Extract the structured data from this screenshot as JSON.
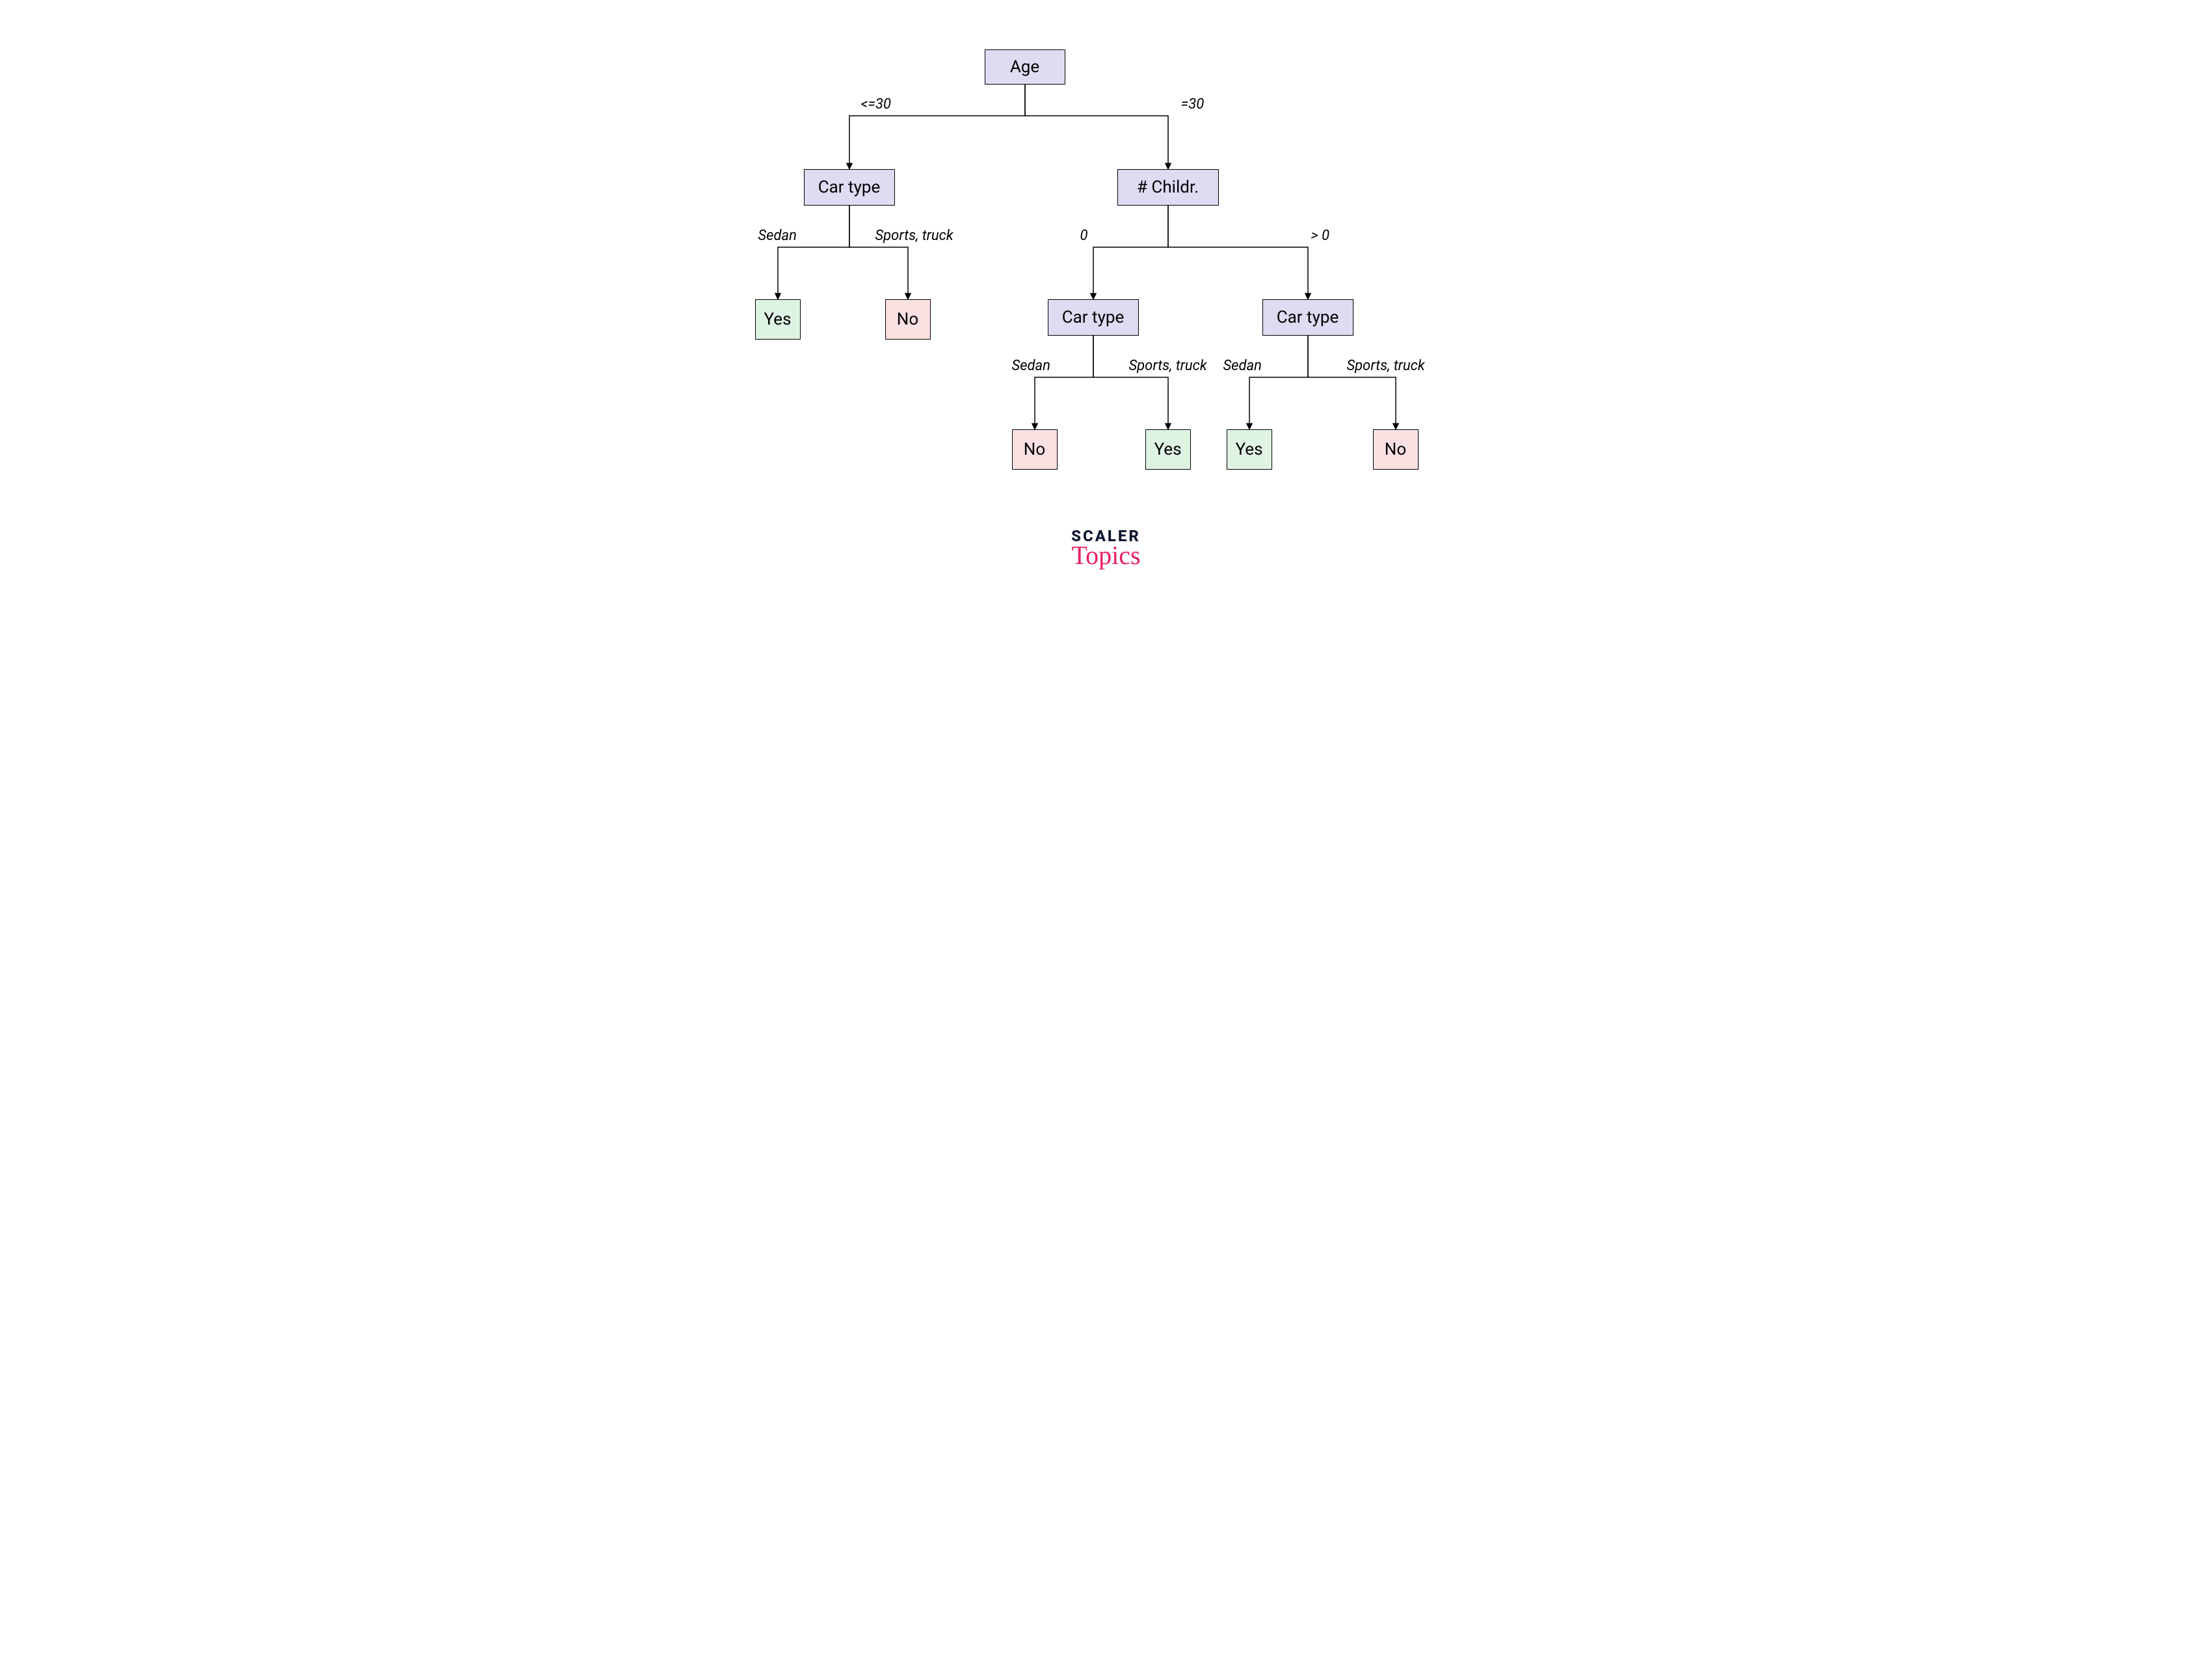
{
  "nodes": {
    "root": {
      "label": "Age"
    },
    "car_left": {
      "label": "Car type"
    },
    "childr": {
      "label": "#  Childr."
    },
    "car_mid": {
      "label": "Car type"
    },
    "car_right": {
      "label": "Car type"
    },
    "yes1": {
      "label": "Yes"
    },
    "no1": {
      "label": "No"
    },
    "no2": {
      "label": "No"
    },
    "yes2": {
      "label": "Yes"
    },
    "yes3": {
      "label": "Yes"
    },
    "no3": {
      "label": "No"
    }
  },
  "edges": {
    "age_le30": {
      "label": "<=30"
    },
    "age_eq30": {
      "label": "=30"
    },
    "sedan1": {
      "label": "Sedan"
    },
    "sports1": {
      "label": "Sports, truck"
    },
    "child0": {
      "label": "0"
    },
    "childgt0": {
      "label": ">   0"
    },
    "sedan2": {
      "label": "Sedan"
    },
    "sports2": {
      "label": "Sports, truck"
    },
    "sedan3": {
      "label": "Sedan"
    },
    "sports3": {
      "label": "Sports, truck"
    }
  },
  "brand": {
    "line1": "SCALER",
    "line2": "Topics"
  },
  "colors": {
    "decision_bg": "#dedcf2",
    "yes_bg": "#dff3e3",
    "no_bg": "#f9e1e1",
    "border": "#000000",
    "brand_primary": "#0b1730",
    "brand_accent": "#e91e63"
  }
}
